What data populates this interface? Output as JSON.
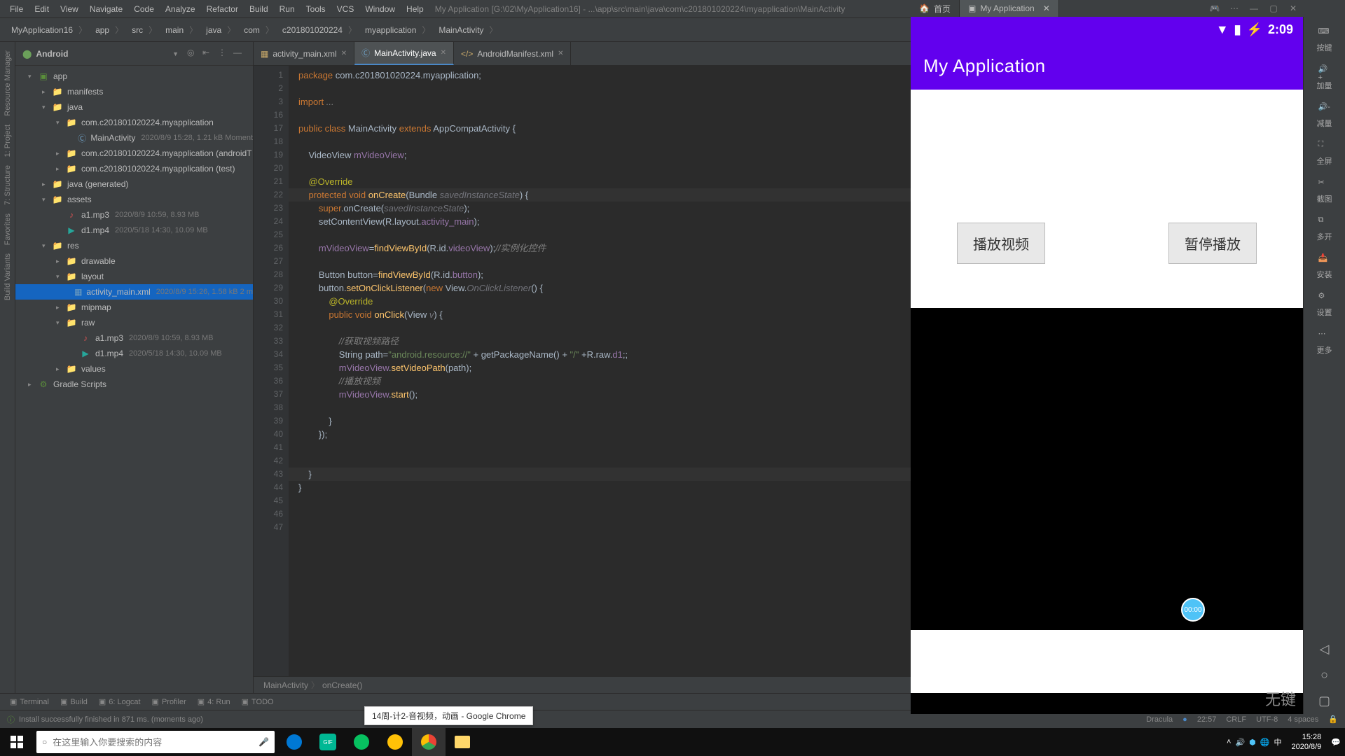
{
  "menubar": [
    "File",
    "Edit",
    "View",
    "Navigate",
    "Code",
    "Analyze",
    "Refactor",
    "Build",
    "Run",
    "Tools",
    "VCS",
    "Window",
    "Help"
  ],
  "title_path": "My Application [G:\\02\\MyApplication16] - ...\\app\\src\\main\\java\\com\\c201801020224\\myapplication\\MainActivity",
  "breadcrumbs": [
    "MyApplication16",
    "app",
    "src",
    "main",
    "java",
    "com",
    "c201801020224",
    "myapplication",
    "MainActivity"
  ],
  "tree_title": "Android",
  "tree": [
    {
      "pad": 18,
      "toggle": "▾",
      "icon": "mod",
      "label": "app"
    },
    {
      "pad": 38,
      "toggle": "▸",
      "icon": "folder",
      "label": "manifests"
    },
    {
      "pad": 38,
      "toggle": "▾",
      "icon": "folder",
      "label": "java"
    },
    {
      "pad": 58,
      "toggle": "▾",
      "icon": "folder",
      "label": "com.c201801020224.myapplication"
    },
    {
      "pad": 78,
      "toggle": "",
      "icon": "class",
      "label": "MainActivity",
      "meta": "2020/8/9 15:28, 1.21 kB  Moment"
    },
    {
      "pad": 58,
      "toggle": "▸",
      "icon": "folder",
      "label": "com.c201801020224.myapplication (androidT"
    },
    {
      "pad": 58,
      "toggle": "▸",
      "icon": "folder",
      "label": "com.c201801020224.myapplication (test)"
    },
    {
      "pad": 38,
      "toggle": "▸",
      "icon": "folder-gen",
      "label": "java (generated)"
    },
    {
      "pad": 38,
      "toggle": "▾",
      "icon": "folder",
      "label": "assets"
    },
    {
      "pad": 58,
      "toggle": "",
      "icon": "audio",
      "label": "a1.mp3",
      "meta": "2020/8/9 10:59, 8.93 MB"
    },
    {
      "pad": 58,
      "toggle": "",
      "icon": "video",
      "label": "d1.mp4",
      "meta": "2020/5/18 14:30, 10.09 MB"
    },
    {
      "pad": 38,
      "toggle": "▾",
      "icon": "folder",
      "label": "res"
    },
    {
      "pad": 58,
      "toggle": "▸",
      "icon": "folder",
      "label": "drawable"
    },
    {
      "pad": 58,
      "toggle": "▾",
      "icon": "folder",
      "label": "layout"
    },
    {
      "pad": 78,
      "toggle": "",
      "icon": "layout",
      "label": "activity_main.xml",
      "meta": "2020/8/9 15:26, 1.58 kB 2 m",
      "sel": true
    },
    {
      "pad": 58,
      "toggle": "▸",
      "icon": "folder",
      "label": "mipmap"
    },
    {
      "pad": 58,
      "toggle": "▾",
      "icon": "folder",
      "label": "raw"
    },
    {
      "pad": 78,
      "toggle": "",
      "icon": "audio",
      "label": "a1.mp3",
      "meta": "2020/8/9 10:59, 8.93 MB"
    },
    {
      "pad": 78,
      "toggle": "",
      "icon": "video",
      "label": "d1.mp4",
      "meta": "2020/5/18 14:30, 10.09 MB"
    },
    {
      "pad": 58,
      "toggle": "▸",
      "icon": "folder",
      "label": "values"
    },
    {
      "pad": 18,
      "toggle": "▸",
      "icon": "gradle",
      "label": "Gradle Scripts"
    }
  ],
  "editor_tabs": [
    {
      "icon": "layout",
      "label": "activity_main.xml",
      "active": false
    },
    {
      "icon": "class",
      "label": "MainActivity.java",
      "active": true
    },
    {
      "icon": "xml",
      "label": "AndroidManifest.xml",
      "active": false
    }
  ],
  "line_start": 1,
  "code_lines": [
    {
      "n": 1,
      "html": "<span class='kw'>package</span> com.c201801020224.myapplication;"
    },
    {
      "n": 2,
      "html": ""
    },
    {
      "n": 3,
      "html": "<span class='kw'>import</span> <span class='cmt'>...</span>"
    },
    {
      "n": 16,
      "html": ""
    },
    {
      "n": 17,
      "html": "<span class='kw'>public class</span> MainActivity <span class='kw'>extends</span> AppCompatActivity {"
    },
    {
      "n": 18,
      "html": ""
    },
    {
      "n": 19,
      "html": "    VideoView <span class='fld'>mVideoView</span>;"
    },
    {
      "n": 20,
      "html": ""
    },
    {
      "n": 21,
      "html": "    <span class='ann'>@Override</span>"
    },
    {
      "n": 22,
      "hl": true,
      "html": "    <span class='kw'>protected void</span> <span class='fn'>onCreate</span>(Bundle <span class='param'>savedInstanceState</span>) {"
    },
    {
      "n": 23,
      "html": "        <span class='kw'>super</span>.onCreate(<span class='param'>savedInstanceState</span>);"
    },
    {
      "n": 24,
      "html": "        setContentView(R.layout.<span class='fld'>activity_main</span>);"
    },
    {
      "n": 25,
      "html": ""
    },
    {
      "n": 26,
      "html": "        <span class='fld'>mVideoView</span>=<span class='fn'>findViewById</span>(R.id.<span class='fld'>videoView</span>);<span class='cmt'>//实例化控件</span>"
    },
    {
      "n": 27,
      "html": ""
    },
    {
      "n": 28,
      "html": "        Button button=<span class='fn'>findViewById</span>(R.id.<span class='fld'>button</span>);"
    },
    {
      "n": 29,
      "html": "        button.<span class='fn'>setOnClickListener</span>(<span class='kw'>new</span> View.<span class='param'>OnClickListener</span>() {"
    },
    {
      "n": 30,
      "html": "            <span class='ann'>@Override</span>"
    },
    {
      "n": 31,
      "html": "            <span class='kw'>public void</span> <span class='fn'>onClick</span>(View <span class='param'>v</span>) {"
    },
    {
      "n": 32,
      "html": ""
    },
    {
      "n": 33,
      "html": "                <span class='cmt'>//获取视频路径</span>"
    },
    {
      "n": 34,
      "html": "                String path=<span class='str'>\"android.resource://\"</span> + getPackageName() + <span class='str'>\"/\"</span> +R.raw.<span class='fld'>d1</span>;;"
    },
    {
      "n": 35,
      "html": "                <span class='fld'>mVideoView</span>.<span class='fn'>setVideoPath</span>(path);"
    },
    {
      "n": 36,
      "html": "                <span class='cmt'>//播放视频</span>"
    },
    {
      "n": 37,
      "html": "                <span class='fld'>mVideoView</span>.<span class='fn'>start</span>();"
    },
    {
      "n": 38,
      "html": ""
    },
    {
      "n": 39,
      "html": "            }"
    },
    {
      "n": 40,
      "html": "        });"
    },
    {
      "n": 41,
      "html": ""
    },
    {
      "n": 42,
      "html": ""
    },
    {
      "n": 43,
      "hl": true,
      "html": "    }"
    },
    {
      "n": 44,
      "html": "}"
    },
    {
      "n": 45,
      "html": ""
    },
    {
      "n": 46,
      "html": ""
    },
    {
      "n": 47,
      "html": ""
    }
  ],
  "bottom_breadcrumb": [
    "MainActivity",
    "onCreate()"
  ],
  "bottom_tabs": [
    "Terminal",
    "Build",
    "6: Logcat",
    "Profiler",
    "4: Run",
    "TODO"
  ],
  "status_msg": "Install successfully finished in 871 ms. (moments ago)",
  "status_right": {
    "scheme": "Dracula",
    "pos": "22:57",
    "eol": "CRLF",
    "enc": "UTF-8",
    "indent": "4 spaces"
  },
  "left_strip": [
    "Resource Manager",
    "1: Project",
    "7: Structure",
    "Favorites",
    "Build Variants"
  ],
  "emulator": {
    "tabs": [
      {
        "label": "首页",
        "icon": "home"
      },
      {
        "label": "My Application",
        "icon": "app",
        "active": true
      }
    ],
    "time": "2:09",
    "app_title": "My Application",
    "btn_play": "播放视频",
    "btn_pause": "暂停播放",
    "seek_label": "00:00",
    "ime": "无键"
  },
  "right_tools": [
    "按键",
    "加量",
    "减量",
    "全屏",
    "截图",
    "多开",
    "安装",
    "设置",
    "更多"
  ],
  "chrome_preview": "14周-计2-音视频，动画 - Google Chrome",
  "taskbar": {
    "search_placeholder": "在这里输入你要搜索的内容",
    "time": "15:28",
    "date": "2020/8/9"
  }
}
